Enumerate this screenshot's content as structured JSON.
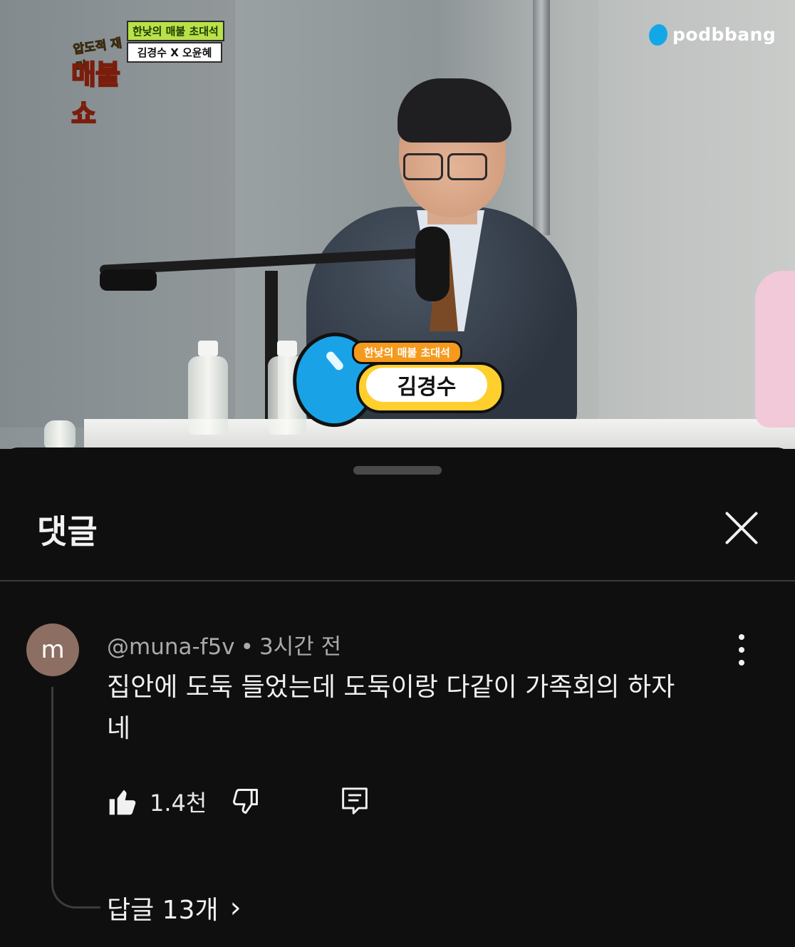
{
  "video": {
    "show_sub": "압도적 재미",
    "show_main": "매불쇼",
    "tag_top": "한낮의 매불 초대석",
    "tag_guests": "김경수 X 오윤혜",
    "brand": "podbbang",
    "caption_tag": "한낮의 매불 초대석",
    "caption_name": "김경수"
  },
  "panel": {
    "title": "댓글",
    "close_icon": "close-icon"
  },
  "comment": {
    "avatar_letter": "m",
    "author": "@muna-f5v",
    "separator": "•",
    "time": "3시간 전",
    "text": "집안에 도둑 들었는데 도둑이랑 다같이 가족회의 하자네",
    "likes": "1.4천",
    "icons": [
      "thumbs-up-icon",
      "thumbs-down-icon",
      "reply-icon",
      "more-vert-icon",
      "chevron-right-icon"
    ],
    "replies_label": "답글 13개",
    "replies_chevron": "›"
  },
  "colors": {
    "panel_bg": "#0f0f0f",
    "text_primary": "#f1f1f1",
    "text_secondary": "#aaaaaa",
    "avatar_bg": "#8d6e63",
    "podbbang_blue": "#12a8e8"
  }
}
